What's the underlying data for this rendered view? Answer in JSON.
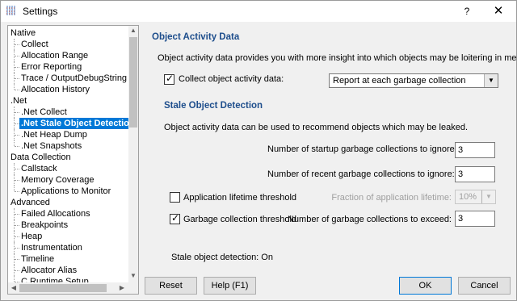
{
  "window": {
    "title": "Settings",
    "help_glyph": "?",
    "close_glyph": "✕"
  },
  "tree": {
    "items": [
      {
        "label": "Native",
        "level": 0
      },
      {
        "label": "Collect",
        "level": 1
      },
      {
        "label": "Allocation Range",
        "level": 1
      },
      {
        "label": "Error Reporting",
        "level": 1
      },
      {
        "label": "Trace / OutputDebugString",
        "level": 1
      },
      {
        "label": "Allocation History",
        "level": 1
      },
      {
        "label": ".Net",
        "level": 0
      },
      {
        "label": ".Net Collect",
        "level": 1
      },
      {
        "label": ".Net Stale Object Detection",
        "level": 1,
        "selected": true
      },
      {
        "label": ".Net Heap Dump",
        "level": 1
      },
      {
        "label": ".Net Snapshots",
        "level": 1
      },
      {
        "label": "Data Collection",
        "level": 0
      },
      {
        "label": "Callstack",
        "level": 1
      },
      {
        "label": "Memory Coverage",
        "level": 1
      },
      {
        "label": "Applications to Monitor",
        "level": 1
      },
      {
        "label": "Advanced",
        "level": 0
      },
      {
        "label": "Failed Allocations",
        "level": 1
      },
      {
        "label": "Breakpoints",
        "level": 1
      },
      {
        "label": "Heap",
        "level": 1
      },
      {
        "label": "Instrumentation",
        "level": 1
      },
      {
        "label": "Timeline",
        "level": 1
      },
      {
        "label": "Allocator Alias",
        "level": 1
      },
      {
        "label": "C Runtime Setup",
        "level": 1
      }
    ]
  },
  "object_activity": {
    "title": "Object Activity Data",
    "description": "Object activity data provides you with more insight into which objects may be loitering in memory.",
    "collect_label": "Collect object activity data:",
    "collect_checked": true,
    "collect_mode": "Report at each garbage collection"
  },
  "stale": {
    "title": "Stale Object Detection",
    "description": "Object activity data can be used to recommend objects which may be leaked.",
    "startup_label": "Number of startup garbage collections to ignore:",
    "startup_value": "3",
    "recent_label": "Number of recent garbage collections to ignore:",
    "recent_value": "3",
    "lifetime_label": "Application lifetime threshold",
    "lifetime_checked": false,
    "fraction_label": "Fraction of application lifetime:",
    "fraction_value": "10%",
    "gc_threshold_label": "Garbage collection threshold",
    "gc_threshold_checked": true,
    "exceed_label": "Number of garbage collections to exceed:",
    "exceed_value": "3",
    "status": "Stale object detection: On"
  },
  "buttons": {
    "reset": "Reset",
    "help": "Help (F1)",
    "ok": "OK",
    "cancel": "Cancel"
  },
  "colors": {
    "accent": "#0078d7",
    "section_title": "#1e4e8c"
  }
}
